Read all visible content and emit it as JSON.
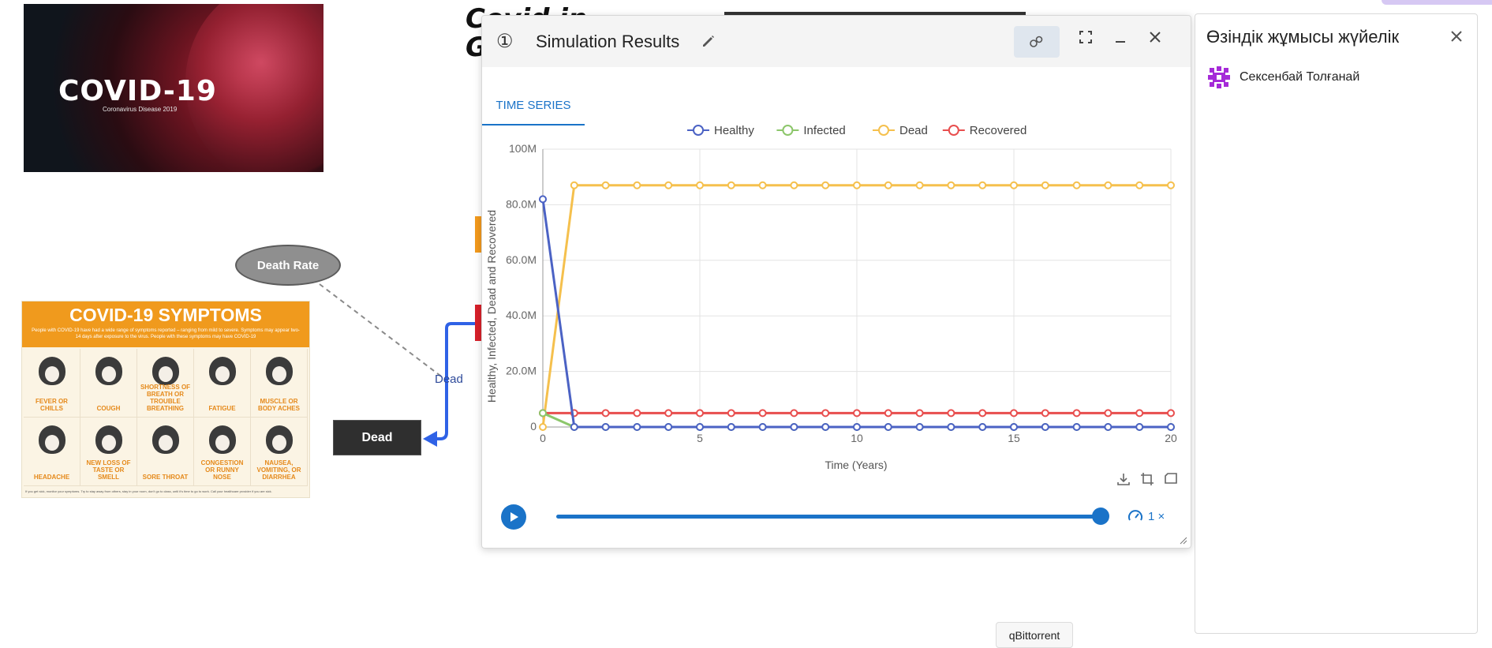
{
  "canvas": {
    "banner": {
      "title": "COVID-19",
      "subtitle": "Coronavirus Disease 2019"
    },
    "fragment_title_line1": "Covid in",
    "fragment_title_line2": "G",
    "death_rate_label": "Death Rate",
    "link_label": "Dead",
    "dead_stock_label": "Dead",
    "symptoms_poster": {
      "title": "COVID-19 SYMPTOMS",
      "description": "People with COVID-19 have had a wide range of symptoms reported – ranging from mild to severe. Symptoms may appear two-14 days after exposure to the virus. People with these symptoms may have COVID-19",
      "items": [
        "FEVER OR CHILLS",
        "COUGH",
        "SHORTNESS OF BREATH OR TROUBLE BREATHING",
        "FATIGUE",
        "MUSCLE OR BODY ACHES",
        "HEADACHE",
        "NEW LOSS OF TASTE OR SMELL",
        "SORE THROAT",
        "CONGESTION OR RUNNY NOSE",
        "NAUSEA, VOMITING, OR DIARRHEA"
      ],
      "footer": "If you get sick, monitor your symptoms. Try to stay away from others, stay in your room, don't go to class, until it's time to go to work. Call your healthcare provider if you are sick."
    }
  },
  "sim_window": {
    "number": "①",
    "title": "Simulation Results",
    "tab_label": "TIME SERIES",
    "speed_label": "1 ×"
  },
  "chart_data": {
    "type": "line",
    "xlabel": "Time (Years)",
    "ylabel": "Healthy, Infected, Dead and Recovered",
    "xlim": [
      0,
      20
    ],
    "ylim": [
      0,
      100000000
    ],
    "x_ticks": [
      0,
      5,
      10,
      15,
      20
    ],
    "y_tick_labels": [
      "0",
      "20.0M",
      "40.0M",
      "60.0M",
      "80.0M",
      "100M"
    ],
    "legend_position": "top-center",
    "grid": true,
    "x": [
      0,
      1,
      2,
      3,
      4,
      5,
      6,
      7,
      8,
      9,
      10,
      11,
      12,
      13,
      14,
      15,
      16,
      17,
      18,
      19,
      20
    ],
    "series": [
      {
        "name": "Healthy",
        "color": "#4b62c4",
        "values": [
          82000000,
          0,
          0,
          0,
          0,
          0,
          0,
          0,
          0,
          0,
          0,
          0,
          0,
          0,
          0,
          0,
          0,
          0,
          0,
          0,
          0
        ]
      },
      {
        "name": "Infected",
        "color": "#8cc66a",
        "values": [
          5000000,
          0,
          0,
          0,
          0,
          0,
          0,
          0,
          0,
          0,
          0,
          0,
          0,
          0,
          0,
          0,
          0,
          0,
          0,
          0,
          0
        ]
      },
      {
        "name": "Dead",
        "color": "#f5c04d",
        "values": [
          0,
          87000000,
          87000000,
          87000000,
          87000000,
          87000000,
          87000000,
          87000000,
          87000000,
          87000000,
          87000000,
          87000000,
          87000000,
          87000000,
          87000000,
          87000000,
          87000000,
          87000000,
          87000000,
          87000000,
          87000000
        ]
      },
      {
        "name": "Recovered",
        "color": "#e84e4e",
        "values": [
          5000000,
          5000000,
          5000000,
          5000000,
          5000000,
          5000000,
          5000000,
          5000000,
          5000000,
          5000000,
          5000000,
          5000000,
          5000000,
          5000000,
          5000000,
          5000000,
          5000000,
          5000000,
          5000000,
          5000000,
          5000000
        ]
      }
    ]
  },
  "right_panel": {
    "title": "Өзіндік жұмысы жүйелік",
    "user_name": "Сексенбай Толғанай"
  },
  "taskbar_tooltip": "qBittorrent",
  "colors": {
    "accent": "#1a73c8"
  }
}
